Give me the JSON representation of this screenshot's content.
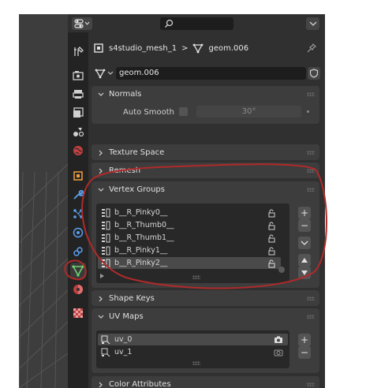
{
  "header": {
    "search_placeholder": ""
  },
  "breadcrumb": {
    "object_name": "s4studio_mesh_1",
    "separator": ">",
    "mesh_name": "geom.006"
  },
  "datablock": {
    "name": "geom.006"
  },
  "normals": {
    "label": "Normals",
    "auto_smooth_label": "Auto Smooth",
    "angle_value": "30°"
  },
  "texture_space": {
    "label": "Texture Space"
  },
  "remesh": {
    "label": "Remesh"
  },
  "vertex_groups": {
    "label": "Vertex Groups",
    "items": [
      "b__R_Pinky0__",
      "b__R_Thumb0__",
      "b__R_Thumb1__",
      "b__R_Pinky1__",
      "b__R_Pinky2__"
    ],
    "selected_index": 4
  },
  "shape_keys": {
    "label": "Shape Keys"
  },
  "uv_maps": {
    "label": "UV Maps",
    "items": [
      "uv_0",
      "uv_1"
    ],
    "selected_index": 0
  },
  "color_attributes": {
    "label": "Color Attributes"
  },
  "colors": {
    "panel": "#3d3d3d",
    "editor": "#303030",
    "list": "#282828",
    "annotation": "#b02a2a",
    "mesh_tab": "#6fd26f"
  }
}
